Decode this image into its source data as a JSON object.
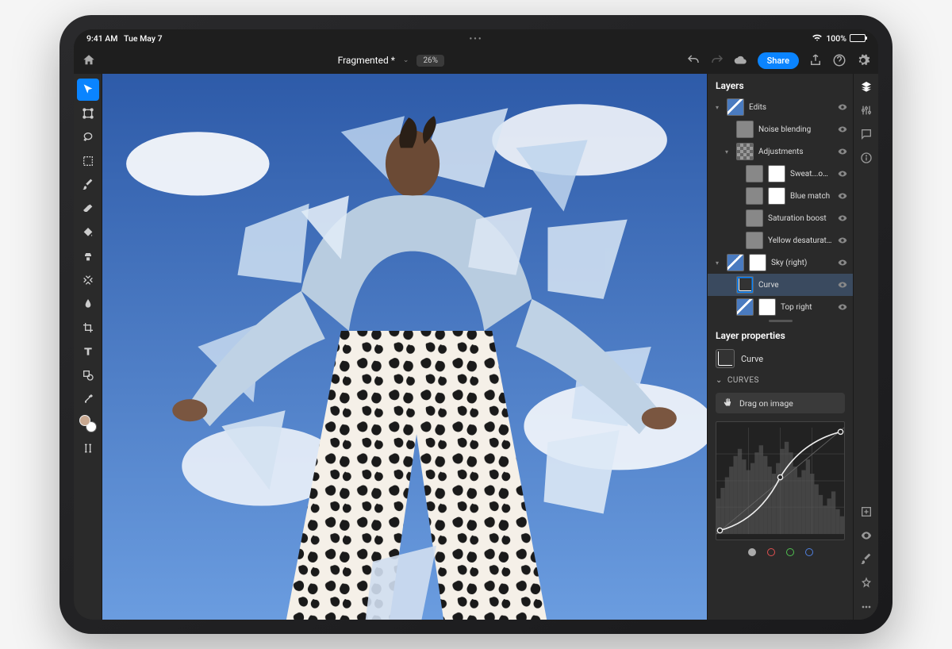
{
  "status": {
    "time": "9:41 AM",
    "date": "Tue May 7",
    "battery": "100%"
  },
  "topbar": {
    "title": "Fragmented *",
    "zoom": "26%",
    "share": "Share"
  },
  "layers_panel": {
    "title": "Layers",
    "items": [
      {
        "name": "Edits",
        "indent": 0,
        "expanded": true,
        "thumb": "sky"
      },
      {
        "name": "Noise blending",
        "indent": 1,
        "thumb": "adj"
      },
      {
        "name": "Adjustments",
        "indent": 1,
        "expanded": true,
        "thumb": "checker"
      },
      {
        "name": "Sweat...ooster",
        "indent": 2,
        "thumb": "adj",
        "mask": true
      },
      {
        "name": "Blue match",
        "indent": 2,
        "thumb": "adj",
        "mask": true
      },
      {
        "name": "Saturation boost",
        "indent": 2,
        "thumb": "adj"
      },
      {
        "name": "Yellow desaturation",
        "indent": 2,
        "thumb": "adj"
      },
      {
        "name": "Sky (right)",
        "indent": 0,
        "expanded": true,
        "thumb": "sky",
        "mask": true
      },
      {
        "name": "Curve",
        "indent": 1,
        "thumb": "curve",
        "selected": true
      },
      {
        "name": "Top right",
        "indent": 1,
        "thumb": "sky",
        "mask": true
      }
    ]
  },
  "properties": {
    "title": "Layer properties",
    "layer_name": "Curve",
    "section": "CURVES",
    "drag_label": "Drag on image"
  }
}
